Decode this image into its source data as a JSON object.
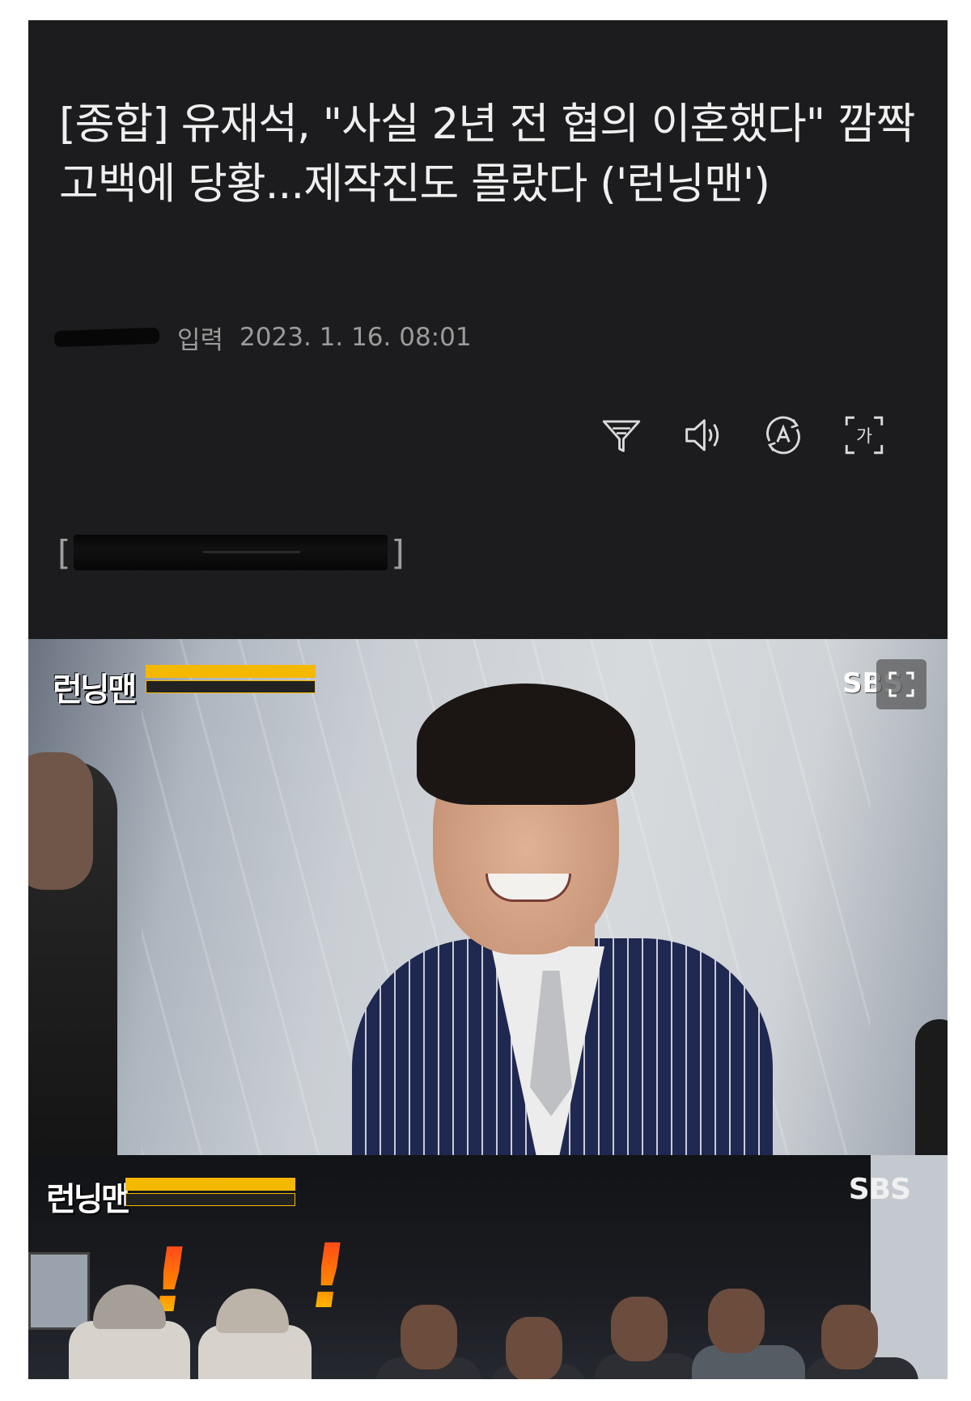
{
  "article": {
    "headline": "[종합] 유재석, \"사실 2년 전 협의 이혼했다\" 깜짝 고백에 당황...제작진도 몰랐다 ('런닝맨')",
    "meta": {
      "label": "입력",
      "timestamp": "2023. 1. 16. 08:01"
    },
    "caption_open": "[",
    "caption_close": "]"
  },
  "toolbar": {
    "buttons": [
      {
        "icon": "summary-filter-icon"
      },
      {
        "icon": "speaker-icon"
      },
      {
        "icon": "translate-icon"
      },
      {
        "icon": "font-size-icon",
        "glyph": "가"
      }
    ]
  },
  "photo": {
    "show_logo": "런닝맨",
    "broadcaster": "SBS",
    "expand_icon": "expand-icon"
  },
  "strip": {
    "show_logo": "런닝맨",
    "broadcaster": "SBS",
    "exclamation": "!"
  },
  "colors": {
    "background": "#1c1c1e",
    "headline_text": "#efefef",
    "meta_text": "#9b9b9b",
    "ticker_yellow": "#f5b800"
  }
}
